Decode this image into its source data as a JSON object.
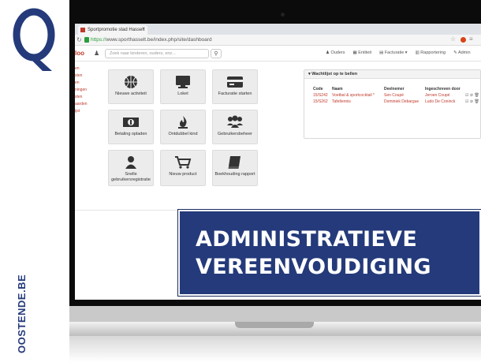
{
  "brand": {
    "vertical_text": "OOSTENDE.BE",
    "color": "#243a7a"
  },
  "browser": {
    "tab_title": "Sportpromotie stad Hasselt",
    "url_protocol": "https://",
    "url_rest": "www.sporthasselt.be/index.php/site/dashboard"
  },
  "app": {
    "logo_text": "loo",
    "search_placeholder": "Zoek naar kinderen, ouders, enz...",
    "nav": [
      "Ouders",
      "Entiteit",
      "Facturatie ▾",
      "Rapportering",
      "Admin"
    ],
    "sidebar_items": [
      "en",
      "sten",
      "en",
      "ningen",
      "sten",
      "aarden",
      "ijst"
    ]
  },
  "tiles": [
    {
      "label": "Nieuwe activiteit",
      "icon": "basketball-icon"
    },
    {
      "label": "Loket",
      "icon": "monitor-icon"
    },
    {
      "label": "Facturatie starten",
      "icon": "credit-card-icon"
    },
    {
      "label": "Betaling opladen",
      "icon": "money-icon"
    },
    {
      "label": "Ontdubbel kind",
      "icon": "fire-icon"
    },
    {
      "label": "Gebruikersbeheer",
      "icon": "users-icon"
    },
    {
      "label": "Snelle gebruikersregistratie",
      "icon": "user-icon"
    },
    {
      "label": "Nieuw product",
      "icon": "cart-icon"
    },
    {
      "label": "Boekhouding rapport",
      "icon": "book-icon"
    }
  ],
  "waitlist": {
    "title": "Wachtlijst op te bellen",
    "columns": [
      "Code",
      "Naam",
      "Deelnemer",
      "Ingeschreven door"
    ],
    "rows": [
      {
        "code": "15/S242",
        "naam": "Voetbal & sportcocktail *",
        "deelnemer": "Sen Coupé",
        "door": "Jeroen Coupé",
        "acts": "☑ ⊘ 🗑"
      },
      {
        "code": "15/S262",
        "naam": "Tafeltennis",
        "deelnemer": "Dominiek Debargue",
        "door": "Ludo De Coninck",
        "acts": "☑ ⊘ 🗑"
      }
    ]
  },
  "banner": {
    "line1": "ADMINISTRATIEVE",
    "line2": "VEREENVOUDIGING",
    "bg_color": "#243a7a"
  }
}
